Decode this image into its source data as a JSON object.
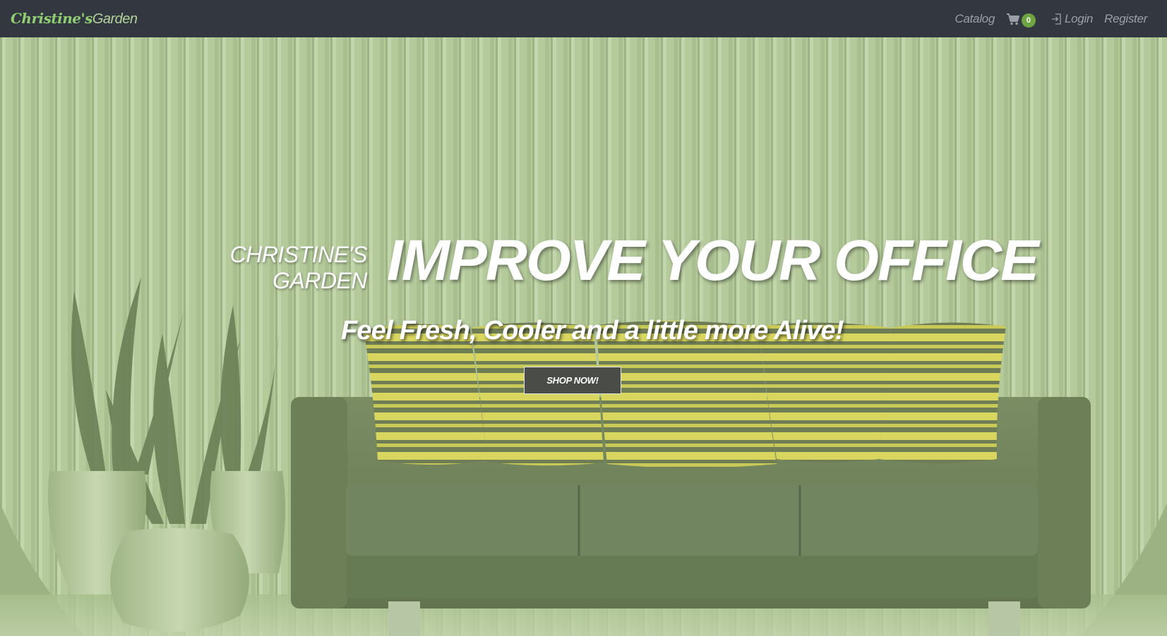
{
  "navbar": {
    "brand_script": "Christine's",
    "brand_rest": "Garden",
    "catalog_label": "Catalog",
    "cart_count": "0",
    "login_label": "Login",
    "register_label": "Register"
  },
  "hero": {
    "brand_line1": "CHRISTINE'S",
    "brand_line2": "GARDEN",
    "headline": "IMPROVE YOUR OFFICE",
    "subline": "Feel Fresh, Cooler and a little more Alive!",
    "cta_label": "SHOP NOW!"
  },
  "colors": {
    "navbar_bg": "#333840",
    "brand_green": "#8fcf72",
    "badge_green": "#6ea542",
    "hero_tint": "#b1c898",
    "nav_text": "#9aa0a8"
  },
  "icons": {
    "cart": "shopping-cart-icon",
    "login": "login-icon"
  }
}
